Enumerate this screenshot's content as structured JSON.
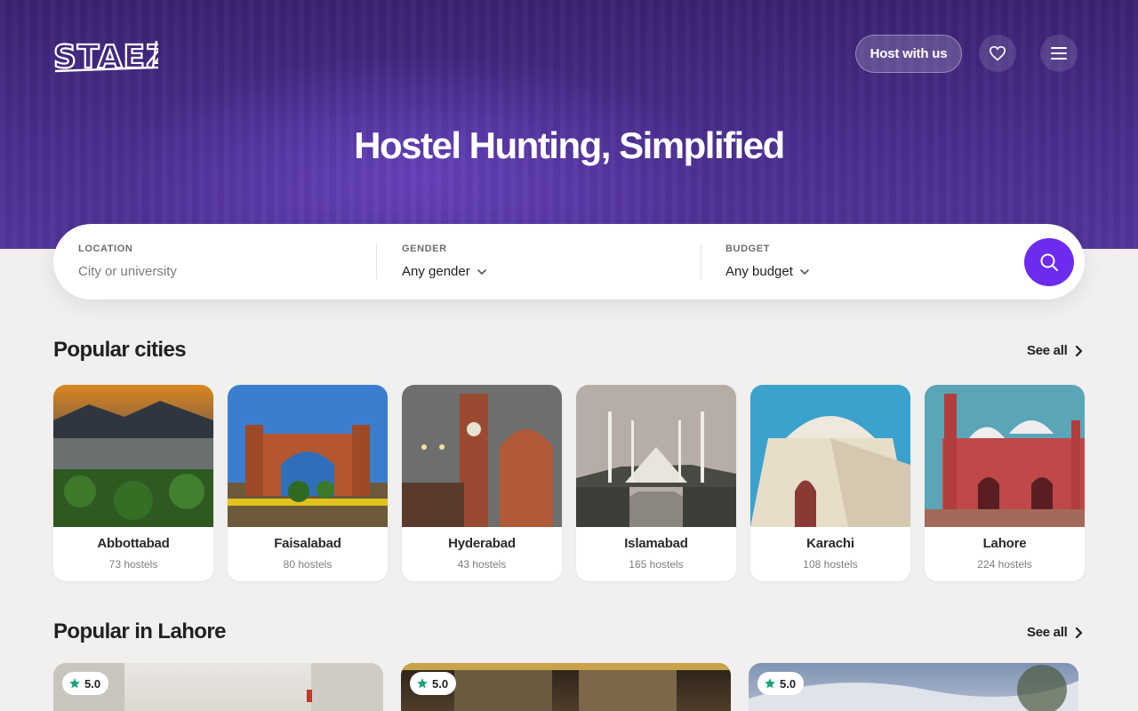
{
  "header": {
    "logo_text": "STAEZY",
    "host_button": "Host with us",
    "favorites_icon": "heart-icon",
    "menu_icon": "menu-icon"
  },
  "hero": {
    "title": "Hostel Hunting, Simplified"
  },
  "search": {
    "location": {
      "label": "LOCATION",
      "placeholder": "City or university"
    },
    "gender": {
      "label": "GENDER",
      "value": "Any gender"
    },
    "budget": {
      "label": "BUDGET",
      "value": "Any budget"
    },
    "button_icon": "search-icon",
    "accent_color": "#6c2bf0"
  },
  "popular_cities": {
    "title": "Popular cities",
    "see_all": "See all",
    "cities": [
      {
        "name": "Abbottabad",
        "count": "73 hostels"
      },
      {
        "name": "Faisalabad",
        "count": "80 hostels"
      },
      {
        "name": "Hyderabad",
        "count": "43 hostels"
      },
      {
        "name": "Islamabad",
        "count": "165 hostels"
      },
      {
        "name": "Karachi",
        "count": "108 hostels"
      },
      {
        "name": "Lahore",
        "count": "224 hostels"
      }
    ]
  },
  "popular_in_lahore": {
    "title": "Popular in Lahore",
    "see_all": "See all",
    "listings": [
      {
        "rating": "5.0"
      },
      {
        "rating": "5.0"
      },
      {
        "rating": "5.0"
      }
    ]
  }
}
